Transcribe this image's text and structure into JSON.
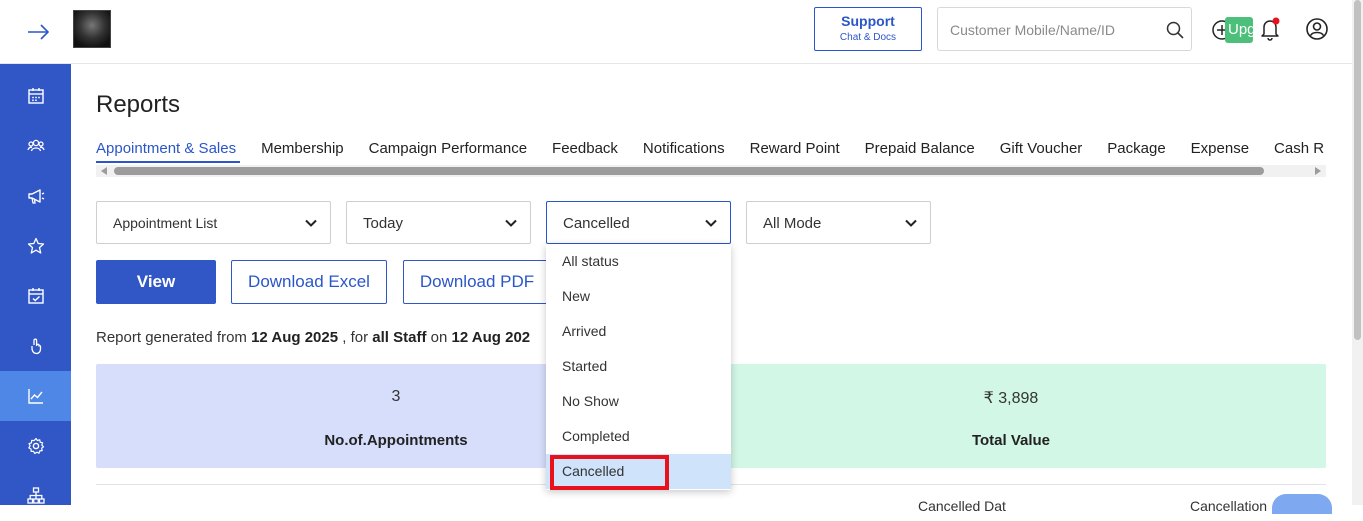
{
  "header": {
    "support_title": "Support",
    "support_subtitle": "Chat & Docs",
    "search_placeholder": "Customer Mobile/Name/ID",
    "upgrade_label": "Upgrade",
    "icons": [
      "expand-arrow-icon",
      "search-icon",
      "plus-circle-icon",
      "bell-icon",
      "user-icon"
    ],
    "notification_dot_color": "#e8121d"
  },
  "sidebar": {
    "items": [
      {
        "icon": "calendar-icon"
      },
      {
        "icon": "customers-icon"
      },
      {
        "icon": "megaphone-icon"
      },
      {
        "icon": "star-icon"
      },
      {
        "icon": "calendar-check-icon"
      },
      {
        "icon": "touch-icon"
      },
      {
        "icon": "reports-chart-icon",
        "active": true
      },
      {
        "icon": "gear-icon"
      },
      {
        "icon": "org-tree-icon"
      }
    ],
    "color": "#3157c6",
    "active_color": "#4f87e6"
  },
  "page": {
    "title": "Reports",
    "tabs": [
      {
        "label": "Appointment & Sales",
        "active": true
      },
      {
        "label": "Membership"
      },
      {
        "label": "Campaign Performance"
      },
      {
        "label": "Feedback"
      },
      {
        "label": "Notifications"
      },
      {
        "label": "Reward Point"
      },
      {
        "label": "Prepaid Balance"
      },
      {
        "label": "Gift Voucher"
      },
      {
        "label": "Package"
      },
      {
        "label": "Expense"
      },
      {
        "label": "Cash R"
      }
    ]
  },
  "filters": {
    "report_type": "Appointment List",
    "period": "Today",
    "status": "Cancelled",
    "mode": "All Mode"
  },
  "status_dropdown": {
    "options": [
      "All status",
      "New",
      "Arrived",
      "Started",
      "No Show",
      "Completed",
      "Cancelled"
    ],
    "selected": "Cancelled"
  },
  "actions": {
    "view": "View",
    "download_excel": "Download Excel",
    "download_pdf": "Download PDF"
  },
  "report_info": {
    "prefix": "Report generated from",
    "from_date": "12 Aug 2025",
    "mid": ", for",
    "staff": "all Staff",
    "on": "on",
    "to_date": "12 Aug 202"
  },
  "summary": {
    "appointments_value": "3",
    "appointments_label": "No.of.Appointments",
    "total_value": "₹ 3,898",
    "total_label": "Total Value"
  },
  "table_partial_headers": [
    "Cancelled Dat",
    "Cancellation"
  ]
}
